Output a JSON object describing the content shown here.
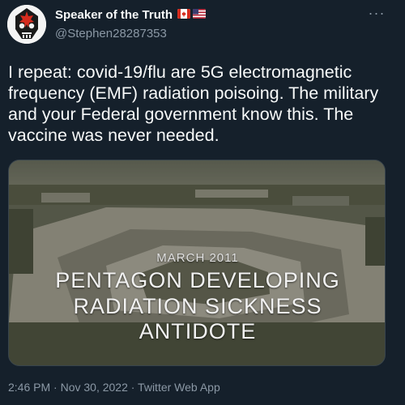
{
  "author": {
    "display_name": "Speaker of the Truth",
    "handle": "@Stephen28287353",
    "flag_icons": [
      "canada-flag-icon",
      "us-flag-icon"
    ]
  },
  "tweet": {
    "text": "I repeat: covid-19/flu are 5G electromagnetic frequency (EMF) radiation poisoing. The military and your Federal government know this. The vaccine was never needed.",
    "more_icon": "more-icon"
  },
  "media": {
    "date": "MARCH 2011",
    "caption_lines": [
      "PENTAGON DEVELOPING",
      "RADIATION SICKNESS",
      "ANTIDOTE"
    ]
  },
  "meta": {
    "time_date_source": "2:46 PM · Nov 30, 2022 · Twitter Web App"
  },
  "colors": {
    "background": "#15202b",
    "text_primary": "#f7f9f9",
    "text_secondary": "#8b98a5"
  }
}
